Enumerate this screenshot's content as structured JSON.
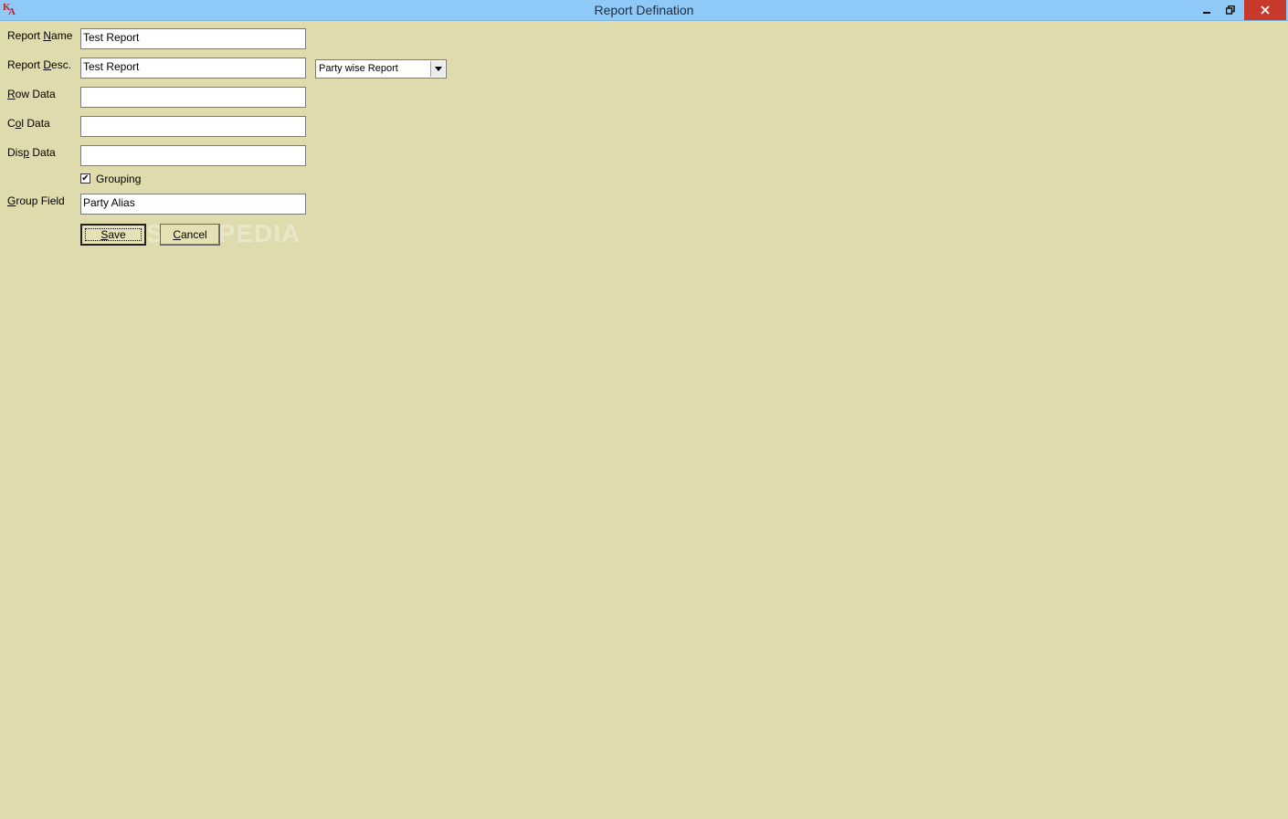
{
  "window": {
    "title": "Report Defination",
    "app_icon_letters": [
      "K",
      "A"
    ],
    "controls": {
      "minimize_icon": "minimize-icon",
      "restore_icon": "restore-icon",
      "close_icon": "close-icon"
    }
  },
  "form": {
    "report_name": {
      "label_pre": "Report ",
      "label_ul": "N",
      "label_post": "ame",
      "value": "Test Report"
    },
    "report_desc": {
      "label_pre": "Report ",
      "label_ul": "D",
      "label_post": "esc.",
      "value": "Test Report"
    },
    "report_type": {
      "selected": "Party wise Report"
    },
    "row_data": {
      "label_pre": "",
      "label_ul": "R",
      "label_post": "ow Data",
      "value": ""
    },
    "col_data": {
      "label_pre": "C",
      "label_ul": "o",
      "label_post": "l Data",
      "value": ""
    },
    "disp_data": {
      "label_pre": "Dis",
      "label_ul": "p",
      "label_post": " Data",
      "value": ""
    },
    "grouping": {
      "label": "Grouping",
      "checked": true
    },
    "group_field": {
      "label_pre": "",
      "label_ul": "G",
      "label_post": "roup Field",
      "value": "Party Alias"
    }
  },
  "buttons": {
    "save": {
      "ul": "S",
      "rest": "ave"
    },
    "cancel": {
      "ul": "C",
      "rest": "ancel"
    }
  },
  "watermark": "SOFTPEDIA",
  "colors": {
    "background": "#dfdbad",
    "titlebar": "#8ec9f7",
    "close": "#c7392b"
  }
}
